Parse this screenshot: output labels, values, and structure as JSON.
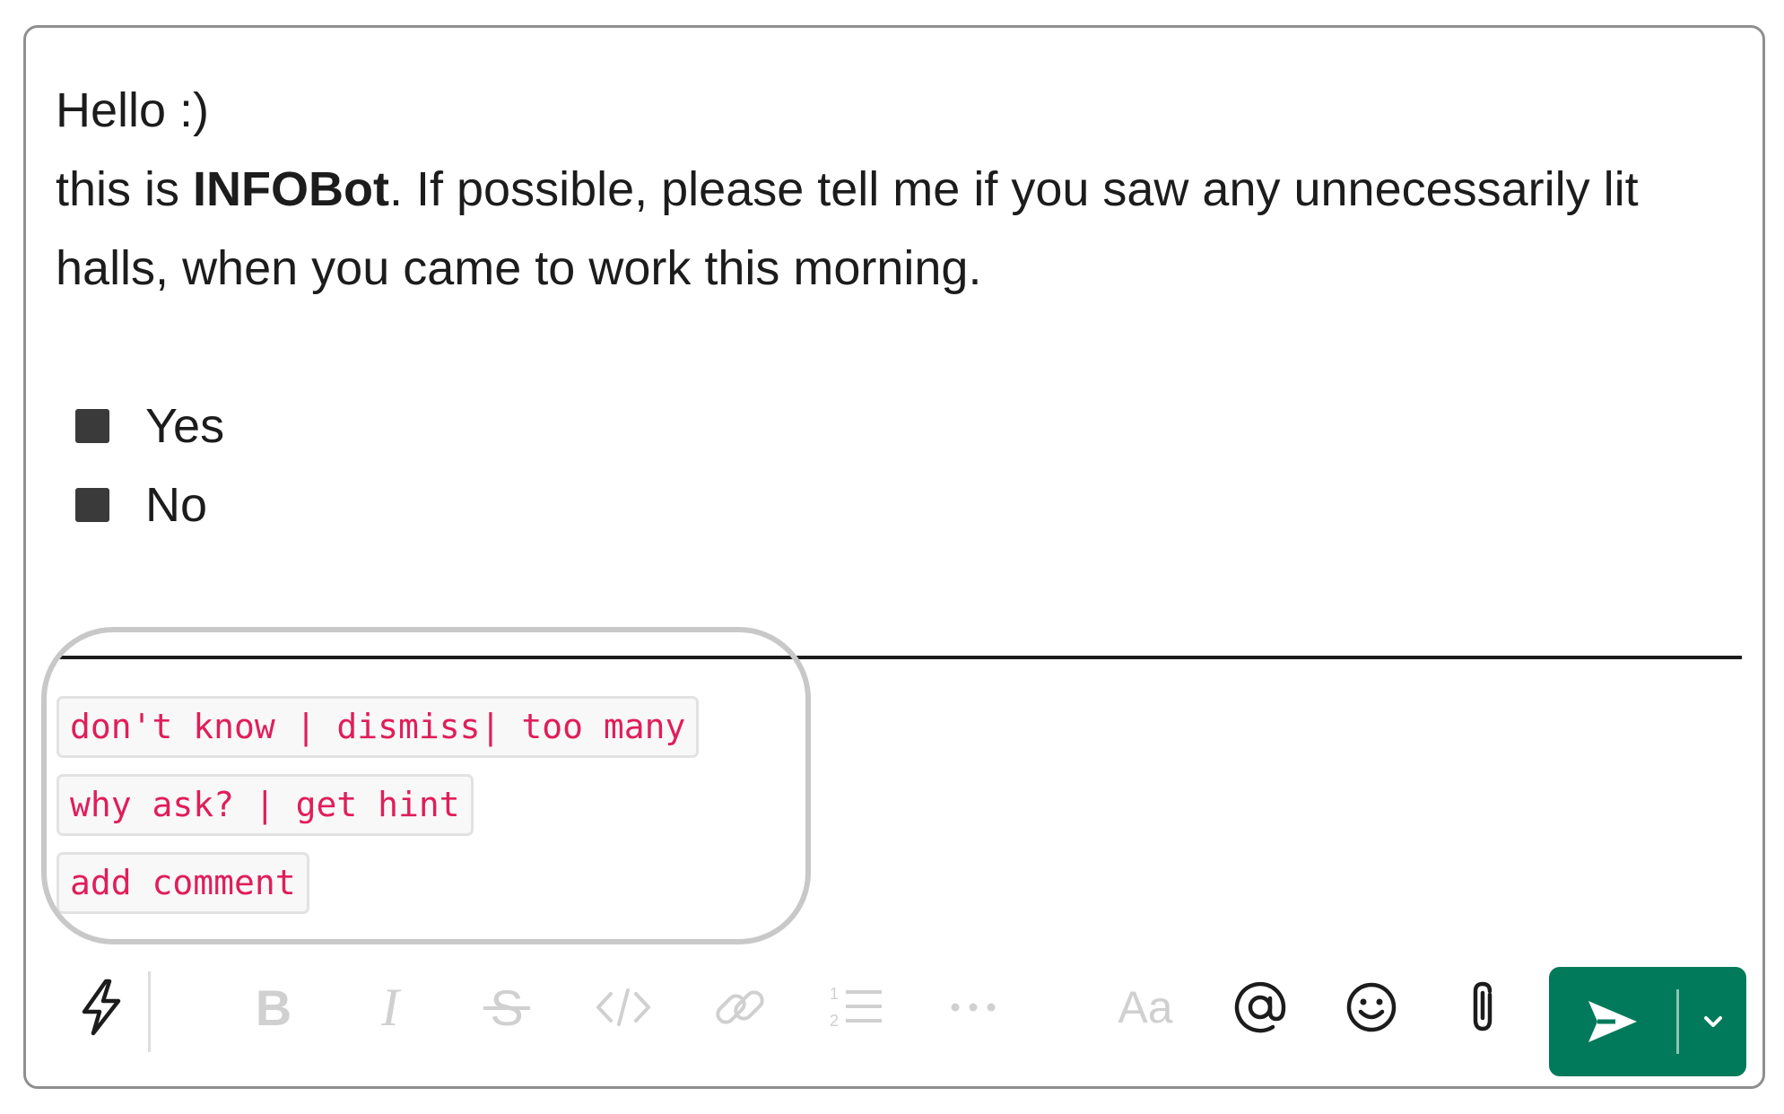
{
  "message": {
    "line1": "Hello :)",
    "line2_prefix": "this is ",
    "bot_name": "INFOBot",
    "line2_suffix": ". If possible, please tell me if you saw any unnecessarily lit halls, when you came to work this morning."
  },
  "options": [
    {
      "label": "Yes"
    },
    {
      "label": "No"
    }
  ],
  "chips": [
    {
      "label": "don't know | dismiss| too many"
    },
    {
      "label": "why ask? | get hint"
    },
    {
      "label": "add comment"
    }
  ],
  "toolbar": {
    "format_label": "Aa",
    "icons": [
      "shortcuts-icon",
      "bold-icon",
      "italic-icon",
      "strikethrough-icon",
      "code-icon",
      "link-icon",
      "ordered-list-icon",
      "more-icon",
      "format-icon",
      "mention-icon",
      "emoji-icon",
      "attach-icon",
      "send-icon",
      "chevron-down-icon"
    ]
  },
  "colors": {
    "chip_text": "#e01e5a",
    "send_bg": "#007a5a",
    "disabled_icon": "#d0d0d0",
    "active_icon": "#1d1c1d"
  }
}
